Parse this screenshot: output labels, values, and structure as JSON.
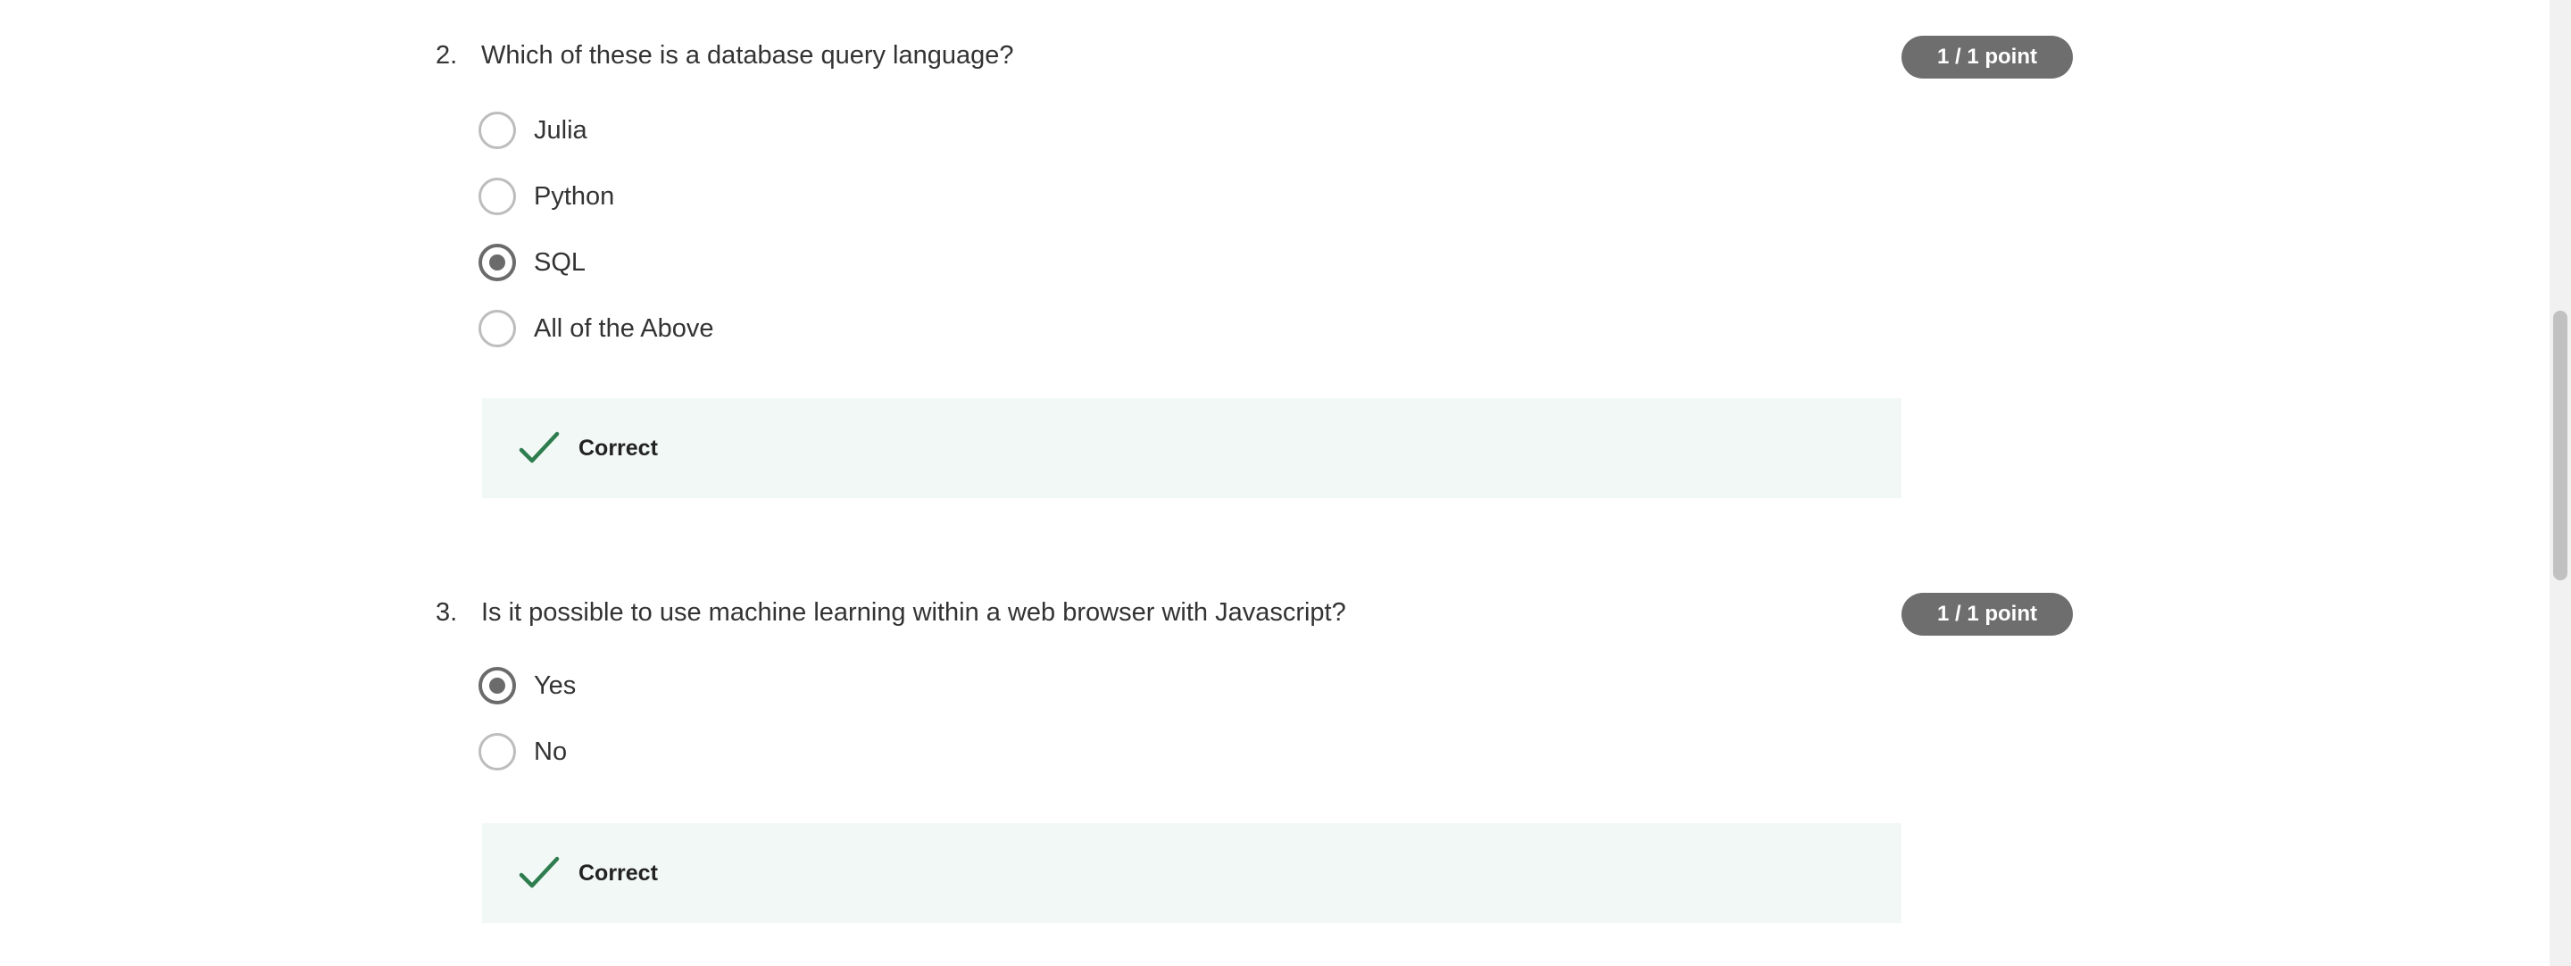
{
  "questions": [
    {
      "number": "2.",
      "text": "Which of these is a database query language?",
      "points": "1 / 1 point",
      "options": [
        {
          "label": "Julia",
          "selected": false
        },
        {
          "label": "Python",
          "selected": false
        },
        {
          "label": "SQL",
          "selected": true
        },
        {
          "label": "All of the Above",
          "selected": false
        }
      ],
      "feedback": {
        "label": "Correct",
        "icon": "check-icon",
        "color": "#2e7d4f"
      }
    },
    {
      "number": "3.",
      "text": "Is it possible to use machine learning within a web browser with Javascript?",
      "points": "1 / 1 point",
      "options": [
        {
          "label": "Yes",
          "selected": true
        },
        {
          "label": "No",
          "selected": false
        }
      ],
      "feedback": {
        "label": "Correct",
        "icon": "check-icon",
        "color": "#2e7d4f"
      }
    }
  ],
  "colors": {
    "badge_bg": "#6e6e6e",
    "feedback_bg": "#f2f8f5",
    "check": "#2e7d4f"
  }
}
